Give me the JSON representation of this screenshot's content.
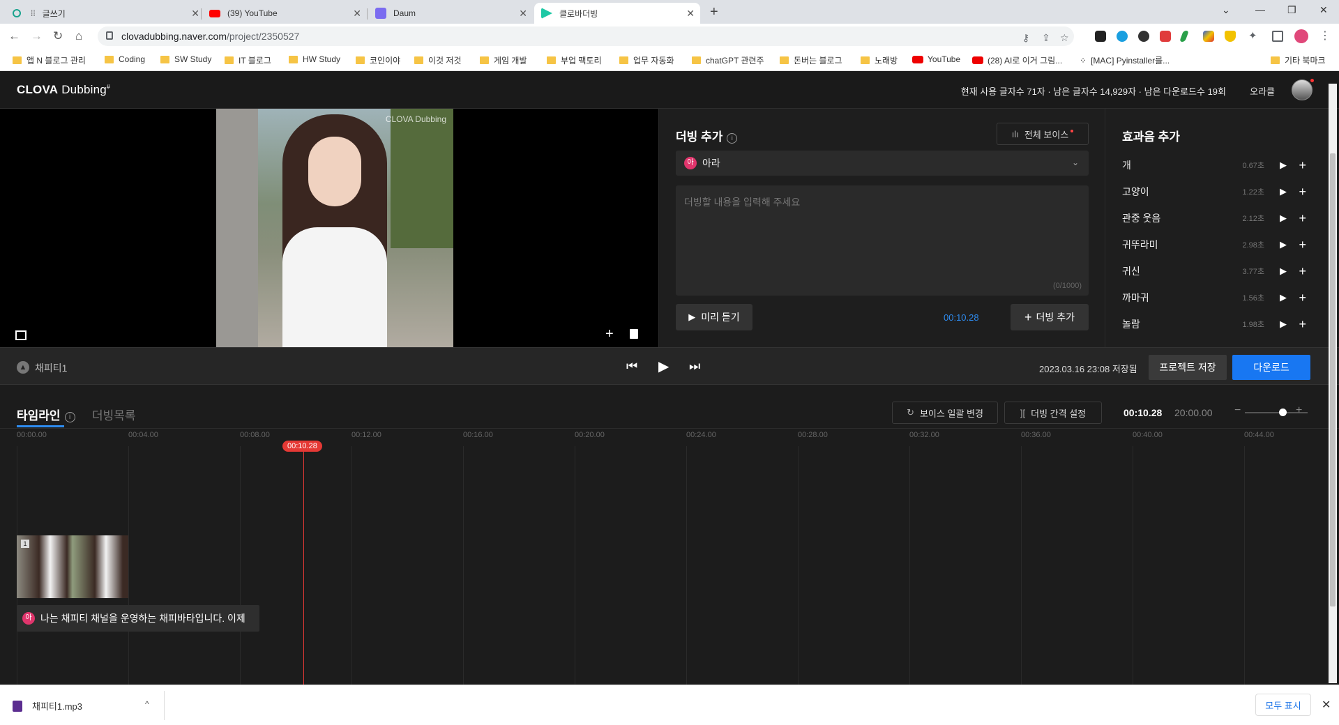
{
  "browser": {
    "tabs": [
      {
        "title": "글쓰기",
        "favicon_color": "#19a38e"
      },
      {
        "title": "(39) YouTube",
        "favicon_color": "#ff0000"
      },
      {
        "title": "Daum",
        "favicon_color": "#7b6cf0"
      },
      {
        "title": "클로바더빙",
        "favicon_color": "#1ec8a5"
      }
    ],
    "active_tab_index": 3,
    "url_host": "clovadubbing.naver.com",
    "url_path": "/project/2350527",
    "bookmarks": [
      {
        "label": "앱 N 블로그 관리",
        "type": "folder"
      },
      {
        "label": "Coding",
        "type": "folder"
      },
      {
        "label": "SW Study",
        "type": "folder"
      },
      {
        "label": "IT 블로그",
        "type": "folder"
      },
      {
        "label": "HW Study",
        "type": "folder"
      },
      {
        "label": "코인이야",
        "type": "folder"
      },
      {
        "label": "이것 저것",
        "type": "folder"
      },
      {
        "label": "게임 개발",
        "type": "folder"
      },
      {
        "label": "부업 팩토리",
        "type": "folder"
      },
      {
        "label": "업무 자동화",
        "type": "folder"
      },
      {
        "label": "chatGPT 관련주",
        "type": "folder"
      },
      {
        "label": "돈버는 블로그",
        "type": "folder"
      },
      {
        "label": "노래방",
        "type": "folder"
      },
      {
        "label": "YouTube",
        "type": "youtube"
      },
      {
        "label": "(28) AI로 이거 그림...",
        "type": "youtube"
      },
      {
        "label": "[MAC] Pyinstaller를...",
        "type": "dots"
      }
    ],
    "other_bookmarks": "기타 북마크"
  },
  "app": {
    "logo_bold": "CLOVA",
    "logo_rest": "Dubbing",
    "usage": "현재 사용 글자수 71자 · 남은 글자수 14,929자 · 남은 다운로드수 19회",
    "username": "오라클"
  },
  "preview": {
    "watermark": "CLOVA Dubbing"
  },
  "dubbing": {
    "title": "더빙 추가",
    "voice_all_label": "전체 보이스",
    "voice_badge": "아",
    "voice_name": "아라",
    "placeholder": "더빙할 내용을 입력해 주세요",
    "char_count": "(0/1000)",
    "preview_label": "미리 듣기",
    "time": "00:10.28",
    "add_label": "더빙 추가"
  },
  "sfx": {
    "title": "효과음 추가",
    "items": [
      {
        "name": "개",
        "length": "0.67초"
      },
      {
        "name": "고양이",
        "length": "1.22초"
      },
      {
        "name": "관중 웃음",
        "length": "2.12초"
      },
      {
        "name": "귀뚜라미",
        "length": "2.98초"
      },
      {
        "name": "귀신",
        "length": "3.77초"
      },
      {
        "name": "까마귀",
        "length": "1.56초"
      },
      {
        "name": "놀람",
        "length": "1.98초"
      }
    ]
  },
  "player": {
    "project_name": "채피티1",
    "saved_text": "2023.03.16 23:08 저장됨",
    "save_label": "프로젝트 저장",
    "download_label": "다운로드"
  },
  "timeline": {
    "tab_timeline": "타임라인",
    "tab_list": "더빙목록",
    "voice_batch_label": "보이스 일괄 변경",
    "interval_label": "더빙 간격 설정",
    "current_time": "00:10.28",
    "total_time": "20:00.00",
    "zoom_level": 0.6,
    "ticks": [
      "00:00.00",
      "00:04.00",
      "00:08.00",
      "00:12.00",
      "00:16.00",
      "00:20.00",
      "00:24.00",
      "00:28.00",
      "00:32.00",
      "00:36.00",
      "00:40.00",
      "00:44.00"
    ],
    "playhead_label": "00:10.28",
    "clip_number": "1",
    "voice_clip_badge": "아",
    "voice_clip_text": "나는 채피티 채널을 운영하는 채피바타입니다. 이제"
  },
  "downloads": {
    "file_name": "채피티1.mp3",
    "show_all": "모두 표시"
  }
}
